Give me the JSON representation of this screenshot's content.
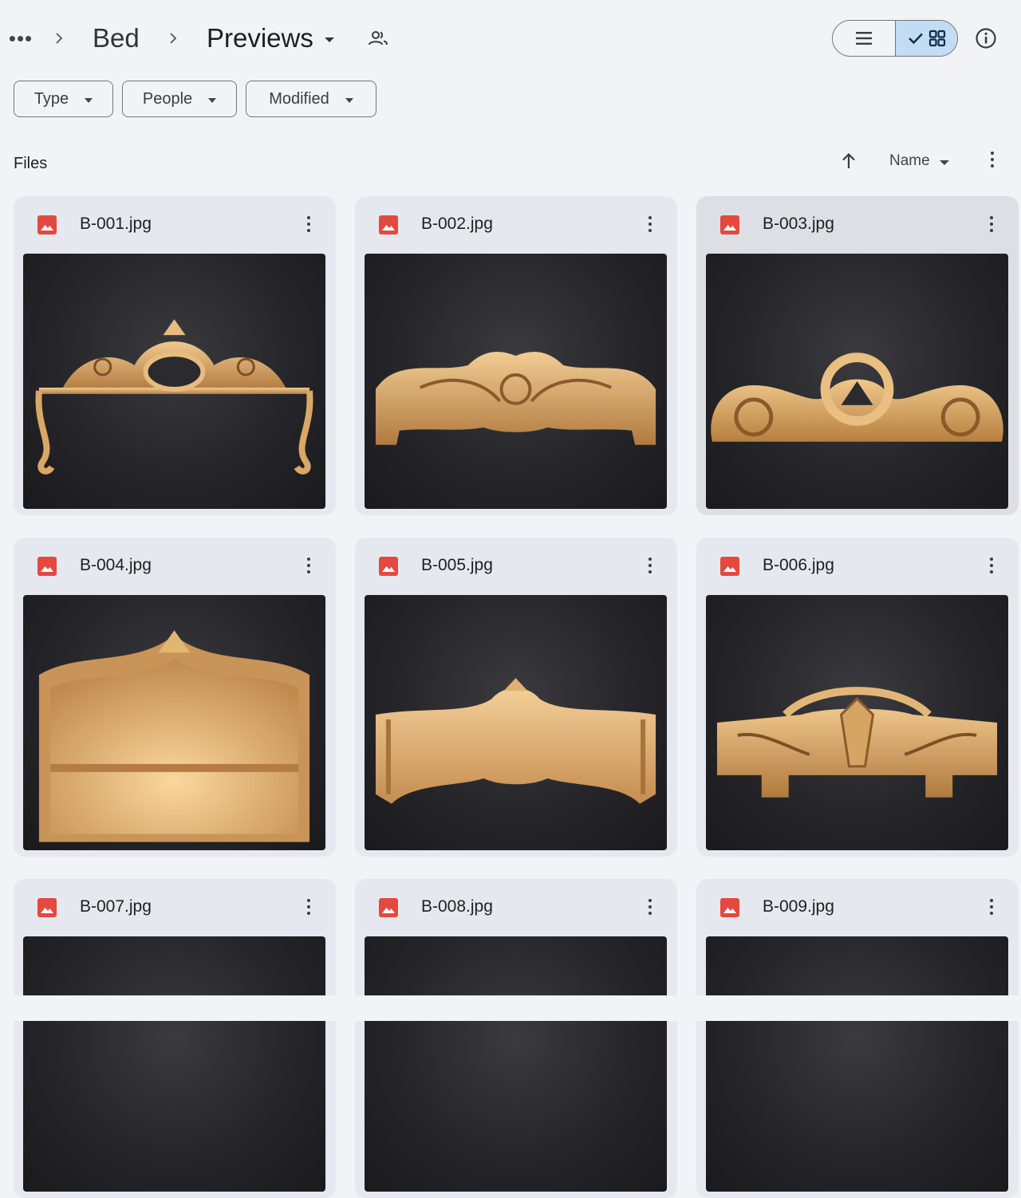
{
  "breadcrumb": {
    "more_label": "•••",
    "items": [
      "Bed",
      "Previews"
    ]
  },
  "filters": [
    {
      "label": "Type"
    },
    {
      "label": "People"
    },
    {
      "label": "Modified"
    }
  ],
  "section": {
    "title": "Files",
    "sort_label": "Name"
  },
  "colors": {
    "accent_selected": "#c2dcf4",
    "image_icon": "#e5483f",
    "carving_gold": "#d9a766"
  },
  "files": [
    {
      "name": "B-001.jpg"
    },
    {
      "name": "B-002.jpg"
    },
    {
      "name": "B-003.jpg"
    },
    {
      "name": "B-004.jpg"
    },
    {
      "name": "B-005.jpg"
    },
    {
      "name": "B-006.jpg"
    },
    {
      "name": "B-007.jpg"
    },
    {
      "name": "B-008.jpg"
    },
    {
      "name": "B-009.jpg"
    }
  ]
}
